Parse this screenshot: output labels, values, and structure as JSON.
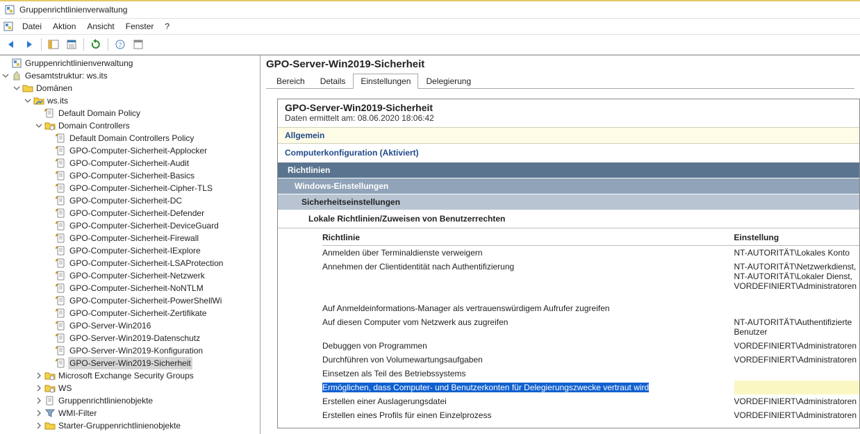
{
  "titlebar": {
    "title": "Gruppenrichtlinienverwaltung"
  },
  "menu": {
    "items": [
      "Datei",
      "Aktion",
      "Ansicht",
      "Fenster",
      "?"
    ]
  },
  "tree": {
    "root": {
      "label": "Gruppenrichtlinienverwaltung"
    },
    "forest": {
      "label": "Gesamtstruktur: ws.its"
    },
    "domains": {
      "label": "Domänen"
    },
    "domain": {
      "label": "ws.its"
    },
    "ddp": {
      "label": "Default Domain Policy"
    },
    "dc": {
      "label": "Domain Controllers"
    },
    "dcgpos": [
      "Default Domain Controllers Policy",
      "GPO-Computer-Sicherheit-Applocker",
      "GPO-Computer-Sicherheit-Audit",
      "GPO-Computer-Sicherheit-Basics",
      "GPO-Computer-Sicherheit-Cipher-TLS",
      "GPO-Computer-Sicherheit-DC",
      "GPO-Computer-Sicherheit-Defender",
      "GPO-Computer-Sicherheit-DeviceGuard",
      "GPO-Computer-Sicherheit-Firewall",
      "GPO-Computer-Sicherheit-IExplore",
      "GPO-Computer-Sicherheit-LSAProtection",
      "GPO-Computer-Sicherheit-Netzwerk",
      "GPO-Computer-Sicherheit-NoNTLM",
      "GPO-Computer-Sicherheit-PowerShellWi",
      "GPO-Computer-Sicherheit-Zertifikate",
      "GPO-Server-Win2016",
      "GPO-Server-Win2019-Datenschutz",
      "GPO-Server-Win2019-Konfiguration",
      "GPO-Server-Win2019-Sicherheit"
    ],
    "siblings": [
      "Microsoft Exchange Security Groups",
      "WS",
      "Gruppenrichtlinienobjekte",
      "WMI-Filter",
      "Starter-Gruppenrichtlinienobjekte"
    ]
  },
  "right": {
    "title": "GPO-Server-Win2019-Sicherheit",
    "tabs": {
      "t0": "Bereich",
      "t1": "Details",
      "t2": "Einstellungen",
      "t3": "Delegierung"
    },
    "report": {
      "title": "GPO-Server-Win2019-Sicherheit",
      "collected": "Daten ermittelt am: 08.06.2020 18:06:42",
      "general": "Allgemein",
      "compconf": "Computerkonfiguration (Aktiviert)",
      "h1": "Richtlinien",
      "h2": "Windows-Einstellungen",
      "h3": "Sicherheitseinstellungen",
      "h4": "Lokale Richtlinien/Zuweisen von Benutzerrechten",
      "th0": "Richtlinie",
      "th1": "Einstellung",
      "rows": [
        {
          "p": "Anmelden über Terminaldienste verweigern",
          "s": "NT-AUTORITÄT\\Lokales Konto"
        },
        {
          "p": "Annehmen der Clientidentität nach Authentifizierung",
          "s": "NT-AUTORITÄT\\Netzwerkdienst, NT-AUTORITÄT\\Lokaler Dienst, VORDEFINIERT\\Administratoren"
        },
        {
          "p": "Auf Anmeldeinformations-Manager als vertrauenswürdigem Aufrufer zugreifen",
          "s": ""
        },
        {
          "p": "Auf diesen Computer vom Netzwerk aus zugreifen",
          "s": "NT-AUTORITÄT\\Authentifizierte Benutzer"
        },
        {
          "p": "Debuggen von Programmen",
          "s": "VORDEFINIERT\\Administratoren"
        },
        {
          "p": "Durchführen von Volumewartungsaufgaben",
          "s": "VORDEFINIERT\\Administratoren"
        },
        {
          "p": "Einsetzen als Teil des Betriebssystems",
          "s": ""
        },
        {
          "p": "Ermöglichen, dass Computer- und Benutzerkonten für Delegierungszwecke vertraut wird",
          "s": ""
        },
        {
          "p": "Erstellen einer Auslagerungsdatei",
          "s": "VORDEFINIERT\\Administratoren"
        },
        {
          "p": "Erstellen eines Profils für einen Einzelprozess",
          "s": "VORDEFINIERT\\Administratoren"
        }
      ]
    }
  }
}
